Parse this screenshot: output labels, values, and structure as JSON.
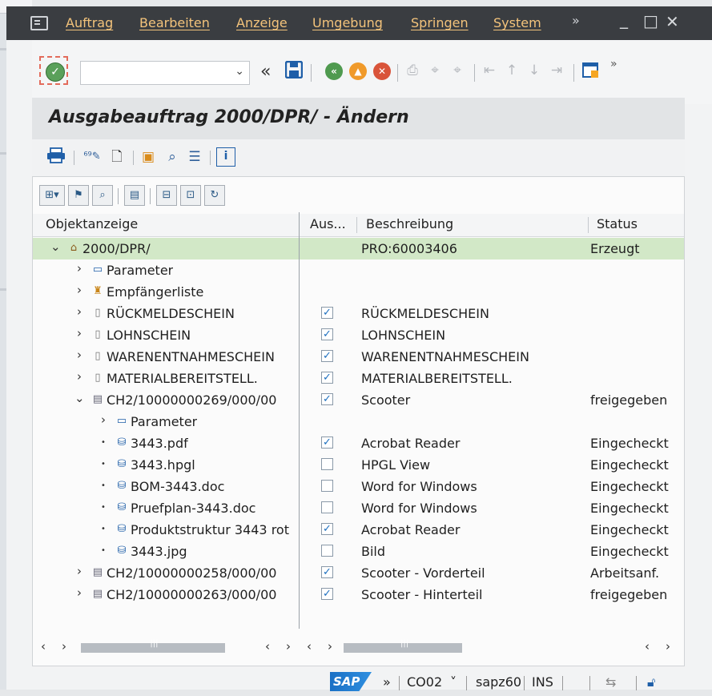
{
  "menubar": {
    "items": [
      "Auftrag",
      "Bearbeiten",
      "Anzeige",
      "Umgebung",
      "Springen",
      "System"
    ],
    "more_label": "»",
    "minimize": "_",
    "maximize": "□",
    "close": "✕"
  },
  "toolbar": {
    "command_field_value": "",
    "back_label": "«",
    "more_label": "»"
  },
  "title": "Ausgabeauftrag 2000/DPR/ - Ändern",
  "tree": {
    "columns": [
      "Objektanzeige",
      "Aus...",
      "Beschreibung",
      "Status"
    ],
    "rows": [
      {
        "level": 0,
        "toggle": "⌄",
        "icon": "order-icon",
        "name": "2000/DPR/",
        "checked": null,
        "desc": "PRO:60003406",
        "status": "Erzeugt",
        "selected": true
      },
      {
        "level": 1,
        "toggle": "›",
        "icon": "parameter-icon",
        "name": "Parameter",
        "checked": null,
        "desc": "",
        "status": ""
      },
      {
        "level": 1,
        "toggle": "›",
        "icon": "recipient-list-icon",
        "name": "Empfängerliste",
        "checked": null,
        "desc": "",
        "status": ""
      },
      {
        "level": 1,
        "toggle": "›",
        "icon": "form-icon",
        "name": "RÜCKMELDESCHEIN",
        "checked": true,
        "desc": "RÜCKMELDESCHEIN",
        "status": ""
      },
      {
        "level": 1,
        "toggle": "›",
        "icon": "form-icon",
        "name": "LOHNSCHEIN",
        "checked": true,
        "desc": "LOHNSCHEIN",
        "status": ""
      },
      {
        "level": 1,
        "toggle": "›",
        "icon": "form-icon",
        "name": "WARENENTNAHMESCHEIN",
        "checked": true,
        "desc": "WARENENTNAHMESCHEIN",
        "status": ""
      },
      {
        "level": 1,
        "toggle": "›",
        "icon": "form-icon",
        "name": "MATERIALBEREITSTELL.",
        "checked": true,
        "desc": "MATERIALBEREITSTELL.",
        "status": ""
      },
      {
        "level": 1,
        "toggle": "⌄",
        "icon": "document-info-record-icon",
        "name": "CH2/10000000269/000/00",
        "checked": true,
        "desc": "Scooter",
        "status": "freigegeben"
      },
      {
        "level": 2,
        "toggle": "›",
        "icon": "parameter-icon",
        "name": "Parameter",
        "checked": null,
        "desc": "",
        "status": ""
      },
      {
        "level": 2,
        "toggle": "•",
        "icon": "original-file-icon",
        "name": "3443.pdf",
        "checked": true,
        "desc": "Acrobat Reader",
        "status": "Eingecheckt"
      },
      {
        "level": 2,
        "toggle": "•",
        "icon": "original-file-icon",
        "name": "3443.hpgl",
        "checked": false,
        "desc": "HPGL View",
        "status": "Eingecheckt"
      },
      {
        "level": 2,
        "toggle": "•",
        "icon": "original-file-icon",
        "name": "BOM-3443.doc",
        "checked": false,
        "desc": "Word for Windows",
        "status": "Eingecheckt"
      },
      {
        "level": 2,
        "toggle": "•",
        "icon": "original-file-icon",
        "name": "Pruefplan-3443.doc",
        "checked": false,
        "desc": "Word for Windows",
        "status": "Eingecheckt"
      },
      {
        "level": 2,
        "toggle": "•",
        "icon": "original-file-icon",
        "name": "Produktstruktur 3443 rot",
        "checked": true,
        "desc": "Acrobat Reader",
        "status": "Eingecheckt"
      },
      {
        "level": 2,
        "toggle": "•",
        "icon": "original-file-icon",
        "name": "3443.jpg",
        "checked": false,
        "desc": "Bild",
        "status": "Eingecheckt"
      },
      {
        "level": 1,
        "toggle": "›",
        "icon": "document-info-record-icon",
        "name": "CH2/10000000258/000/00",
        "checked": true,
        "desc": "Scooter - Vorderteil",
        "status": "Arbeitsanf."
      },
      {
        "level": 1,
        "toggle": "›",
        "icon": "document-info-record-icon",
        "name": "CH2/10000000263/000/00",
        "checked": true,
        "desc": "Scooter - Hinterteil",
        "status": "freigegeben"
      }
    ]
  },
  "statusbar": {
    "logo": "SAP",
    "more": "»",
    "transaction": "CO02",
    "transaction_chevron": "˅",
    "server": "sapz60",
    "mode": "INS"
  },
  "colors": {
    "menubar_bg": "#3a3d41",
    "menu_text": "#f3c37b",
    "selected_row": "#d2e8c7",
    "checkbox_check": "#1d6fbf"
  }
}
